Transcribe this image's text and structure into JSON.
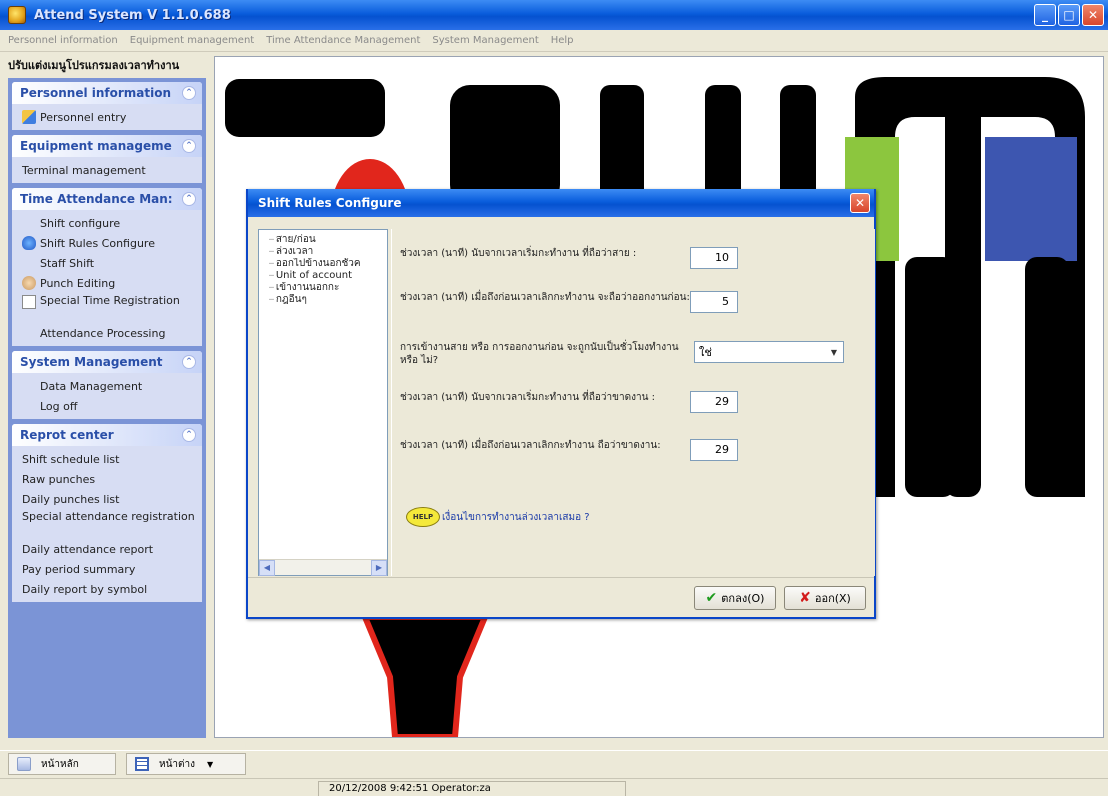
{
  "window": {
    "title": "Attend System V 1.1.0.688",
    "minimize": "_",
    "maximize": "□",
    "close": "✕"
  },
  "menu": [
    "Personnel information",
    "Equipment management",
    "Time Attendance Management",
    "System Management",
    "Help"
  ],
  "nav": {
    "header": "ปรับแต่งเมนูโปรแกรมลงเวลาทำงาน",
    "groups": [
      {
        "title": "Personnel information",
        "items": [
          "Personnel entry"
        ]
      },
      {
        "title": "Equipment manageme",
        "items": [
          "Terminal management"
        ]
      },
      {
        "title": "Time Attendance Man:",
        "items": [
          "Shift configure",
          "Shift Rules Configure",
          "Staff Shift",
          "Punch Editing",
          "Special Time Registration",
          "Attendance Processing"
        ]
      },
      {
        "title": "System Management",
        "items": [
          "Data Management",
          "Log off"
        ]
      },
      {
        "title": "Reprot center",
        "items": [
          "Shift schedule list",
          "Raw punches",
          "Daily punches list",
          "Special attendance registration",
          "Daily attendance report",
          "Pay period summary",
          "Daily report by symbol"
        ]
      }
    ]
  },
  "dialog": {
    "title": "Shift Rules Configure",
    "tree": [
      "สาย/ก่อน",
      "ล่วงเวลา",
      "ออกไปข้างนอกชั่วค",
      "Unit of account",
      "เข้างานนอกกะ",
      "กฎอื่นๆ"
    ],
    "fields": [
      {
        "label": "ช่วงเวลา (นาที) นับจากเวลาเริ่มกะทำงาน ที่ถือว่าสาย :",
        "value": "10"
      },
      {
        "label": "ช่วงเวลา (นาที) เมื่อถึงก่อนเวลาเลิกกะทำงาน จะถือว่าออกงานก่อน:",
        "value": "5"
      },
      {
        "label": "การเข้างานสาย หรือ การออกงานก่อน จะถูกนับเป็นชั่วโมงทำงาน หรือ ไม่?",
        "select": "ใช่"
      },
      {
        "label": "ช่วงเวลา (นาที) นับจากเวลาเริ่มกะทำงาน ที่ถือว่าขาดงาน :",
        "value": "29"
      },
      {
        "label": "ช่วงเวลา (นาที) เมื่อถึงก่อนเวลาเลิกกะทำงาน ถือว่าขาดงาน:",
        "value": "29"
      }
    ],
    "help_icon": "HELP",
    "help_link": "เงื่อนไขการทำงานล่วงเวลาเสมอ ?",
    "ok_label": "ตกลง(O)",
    "exit_label": "ออก(X)"
  },
  "toolbar": {
    "home_label": "หน้าหลัก",
    "window_label": "หน้าต่าง"
  },
  "status": {
    "text": "20/12/2008 9:42:51 Operator:za"
  },
  "colors": {
    "title_blue": "#0552d0",
    "nav_bg": "#7b94d6",
    "group_title": "#2a4fa8",
    "close_red": "#d8462c"
  }
}
